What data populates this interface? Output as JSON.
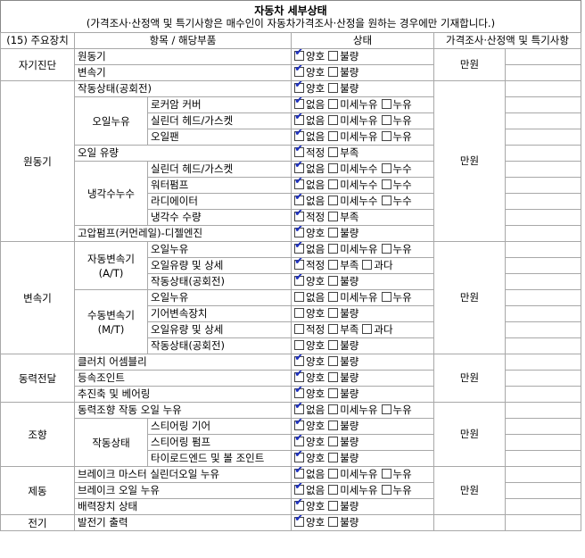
{
  "header": {
    "title": "자동차 세부상태",
    "subtitle": "(가격조사·산정액 및 특기사항은 매수인이 자동차가격조사·산정을 원하는 경우에만 기재합니다.)"
  },
  "columns": {
    "device": "(15) 주요장치",
    "item": "항목 / 해당부품",
    "status": "상태",
    "price": "가격조사·산정액 및 특기사항"
  },
  "price_unit": "만원",
  "options": {
    "good": "양호",
    "bad": "불량",
    "none": "없음",
    "minor_leak": "미세누유",
    "leak": "누유",
    "minor_seep": "미세누수",
    "seep": "누수",
    "proper": "적정",
    "short": "부족",
    "excess": "과다"
  },
  "sections": [
    {
      "name": "자기진단",
      "rows": [
        {
          "item": "원동기",
          "options": [
            [
              "good",
              true
            ],
            [
              "bad",
              false
            ]
          ]
        },
        {
          "item": "변속기",
          "options": [
            [
              "good",
              true
            ],
            [
              "bad",
              false
            ]
          ]
        }
      ]
    },
    {
      "name": "원동기",
      "rows": [
        {
          "item": "작동상태(공회전)",
          "options": [
            [
              "good",
              true
            ],
            [
              "bad",
              false
            ]
          ]
        },
        {
          "group": "오일누유",
          "item": "로커암 커버",
          "options": [
            [
              "none",
              true
            ],
            [
              "minor_leak",
              false
            ],
            [
              "leak",
              false
            ]
          ]
        },
        {
          "group": "오일누유",
          "item": "실린더 헤드/가스켓",
          "options": [
            [
              "none",
              true
            ],
            [
              "minor_leak",
              false
            ],
            [
              "leak",
              false
            ]
          ]
        },
        {
          "group": "오일누유",
          "item": "오일팬",
          "options": [
            [
              "none",
              true
            ],
            [
              "minor_leak",
              false
            ],
            [
              "leak",
              false
            ]
          ]
        },
        {
          "item": "오일 유량",
          "options": [
            [
              "proper",
              true
            ],
            [
              "short",
              false
            ]
          ]
        },
        {
          "group": "냉각수누수",
          "item": "실린더 헤드/가스켓",
          "options": [
            [
              "none",
              true
            ],
            [
              "minor_seep",
              false
            ],
            [
              "seep",
              false
            ]
          ]
        },
        {
          "group": "냉각수누수",
          "item": "워터펌프",
          "options": [
            [
              "none",
              true
            ],
            [
              "minor_seep",
              false
            ],
            [
              "seep",
              false
            ]
          ]
        },
        {
          "group": "냉각수누수",
          "item": "라디에이터",
          "options": [
            [
              "none",
              true
            ],
            [
              "minor_seep",
              false
            ],
            [
              "seep",
              false
            ]
          ]
        },
        {
          "group": "냉각수누수",
          "item": "냉각수 수량",
          "options": [
            [
              "proper",
              true
            ],
            [
              "short",
              false
            ]
          ]
        },
        {
          "item": "고압펌프(커먼레일)-디젤엔진",
          "options": [
            [
              "good",
              true
            ],
            [
              "bad",
              false
            ]
          ]
        }
      ]
    },
    {
      "name": "변속기",
      "rows": [
        {
          "group": "자동변속기\n(A/T)",
          "item": "오일누유",
          "options": [
            [
              "none",
              true
            ],
            [
              "minor_leak",
              false
            ],
            [
              "leak",
              false
            ]
          ]
        },
        {
          "group": "자동변속기\n(A/T)",
          "item": "오일유량 및 상세",
          "options": [
            [
              "proper",
              true
            ],
            [
              "short",
              false
            ],
            [
              "excess",
              false
            ]
          ]
        },
        {
          "group": "자동변속기\n(A/T)",
          "item": "작동상태(공회전)",
          "options": [
            [
              "good",
              true
            ],
            [
              "bad",
              false
            ]
          ]
        },
        {
          "group": "수동변속기\n(M/T)",
          "item": "오일누유",
          "options": [
            [
              "none",
              false
            ],
            [
              "minor_leak",
              false
            ],
            [
              "leak",
              false
            ]
          ]
        },
        {
          "group": "수동변속기\n(M/T)",
          "item": "기어변속장치",
          "options": [
            [
              "good",
              false
            ],
            [
              "bad",
              false
            ]
          ]
        },
        {
          "group": "수동변속기\n(M/T)",
          "item": "오일유량 및 상세",
          "options": [
            [
              "proper",
              false
            ],
            [
              "short",
              false
            ],
            [
              "excess",
              false
            ]
          ]
        },
        {
          "group": "수동변속기\n(M/T)",
          "item": "작동상태(공회전)",
          "options": [
            [
              "good",
              false
            ],
            [
              "bad",
              false
            ]
          ]
        }
      ]
    },
    {
      "name": "동력전달",
      "rows": [
        {
          "item": "클러치 어셈블리",
          "options": [
            [
              "good",
              true
            ],
            [
              "bad",
              false
            ]
          ]
        },
        {
          "item": "등속조인트",
          "options": [
            [
              "good",
              true
            ],
            [
              "bad",
              false
            ]
          ]
        },
        {
          "item": "추진축 및 베어링",
          "options": [
            [
              "good",
              true
            ],
            [
              "bad",
              false
            ]
          ]
        }
      ]
    },
    {
      "name": "조향",
      "rows": [
        {
          "item": "동력조향 작동 오일 누유",
          "options": [
            [
              "none",
              true
            ],
            [
              "minor_leak",
              false
            ],
            [
              "leak",
              false
            ]
          ]
        },
        {
          "group": "작동상태",
          "item": "스티어링 기어",
          "options": [
            [
              "good",
              true
            ],
            [
              "bad",
              false
            ]
          ]
        },
        {
          "group": "작동상태",
          "item": "스티어링 펌프",
          "options": [
            [
              "good",
              true
            ],
            [
              "bad",
              false
            ]
          ]
        },
        {
          "group": "작동상태",
          "item": "타이로드엔드 및 볼 조인트",
          "options": [
            [
              "good",
              true
            ],
            [
              "bad",
              false
            ]
          ]
        }
      ]
    },
    {
      "name": "제동",
      "rows": [
        {
          "item": "브레이크 마스터 실린더오일 누유",
          "options": [
            [
              "none",
              true
            ],
            [
              "minor_leak",
              false
            ],
            [
              "leak",
              false
            ]
          ]
        },
        {
          "item": "브레이크 오일 누유",
          "options": [
            [
              "none",
              true
            ],
            [
              "minor_leak",
              false
            ],
            [
              "leak",
              false
            ]
          ]
        },
        {
          "item": "배력장치 상태",
          "options": [
            [
              "good",
              true
            ],
            [
              "bad",
              false
            ]
          ]
        }
      ]
    },
    {
      "name": "전기",
      "rows": [
        {
          "item": "발전기 출력",
          "options": [
            [
              "good",
              true
            ],
            [
              "bad",
              false
            ]
          ]
        }
      ]
    }
  ]
}
